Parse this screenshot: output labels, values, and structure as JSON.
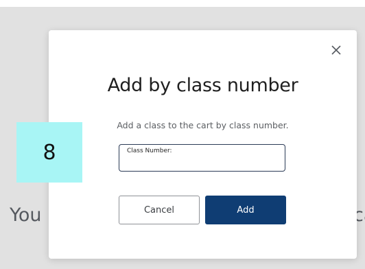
{
  "background": {
    "text_left": "You",
    "text_right": "ca"
  },
  "modal": {
    "title": "Add by class number",
    "description": "Add a class to the cart by class number.",
    "close_icon": "close-icon",
    "input": {
      "label": "Class Number:",
      "value": "",
      "placeholder": ""
    },
    "buttons": {
      "cancel_label": "Cancel",
      "add_label": "Add"
    }
  },
  "overlay": {
    "step_number": "8"
  },
  "colors": {
    "primary_button": "#0f3d73",
    "step_badge": "#a8f5f5",
    "backdrop": "#e1e1e1"
  }
}
